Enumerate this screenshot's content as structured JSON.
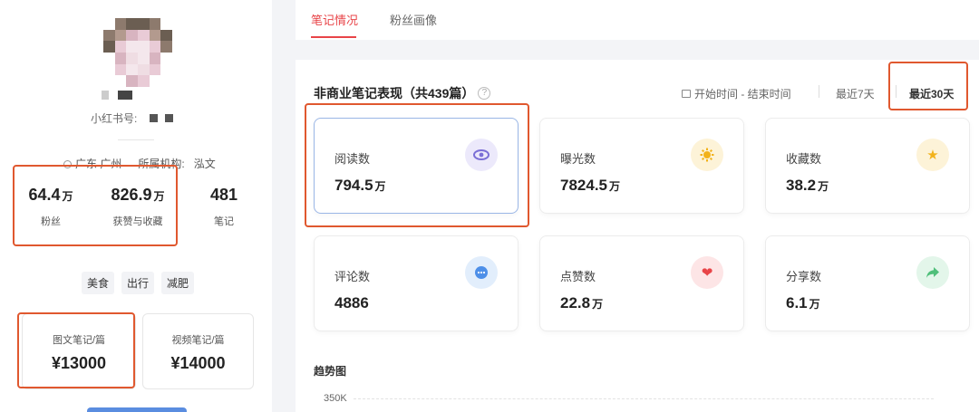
{
  "profile": {
    "uid_label": "小红书号:",
    "location": "广东 广州",
    "org_label": "所属机构:",
    "org_value": "泓文",
    "stats": [
      {
        "value": "64.4",
        "unit": "万",
        "label": "粉丝"
      },
      {
        "value": "826.9",
        "unit": "万",
        "label": "获赞与收藏"
      },
      {
        "value": "481",
        "unit": "",
        "label": "笔记"
      }
    ],
    "tags": [
      "美食",
      "出行",
      "减肥"
    ],
    "prices": [
      {
        "label": "图文笔记/篇",
        "value": "¥13000"
      },
      {
        "label": "视频笔记/篇",
        "value": "¥14000"
      }
    ]
  },
  "tabs": [
    {
      "label": "笔记情况",
      "active": true
    },
    {
      "label": "粉丝画像",
      "active": false
    }
  ],
  "section": {
    "title": "非商业笔记表现（共439篇）",
    "help": "?",
    "date_range": "开始时间 - 结束时间",
    "range_options": [
      {
        "label": "最近7天",
        "active": false
      },
      {
        "label": "最近30天",
        "active": true
      }
    ]
  },
  "metrics": [
    {
      "label": "阅读数",
      "value": "794.5",
      "unit": "万",
      "icon": "eye-icon",
      "color": "#7b6fd6",
      "bg": "#ece9fb"
    },
    {
      "label": "曝光数",
      "value": "7824.5",
      "unit": "万",
      "icon": "sun-icon",
      "color": "#f2b21b",
      "bg": "#fdf3d8"
    },
    {
      "label": "收藏数",
      "value": "38.2",
      "unit": "万",
      "icon": "star-icon",
      "color": "#f2b21b",
      "bg": "#fdf3d8"
    },
    {
      "label": "评论数",
      "value": "4886",
      "unit": "",
      "icon": "comment-icon",
      "color": "#4d8fe8",
      "bg": "#e2eefc"
    },
    {
      "label": "点赞数",
      "value": "22.8",
      "unit": "万",
      "icon": "heart-icon",
      "color": "#e84448",
      "bg": "#fde5e6"
    },
    {
      "label": "分享数",
      "value": "6.1",
      "unit": "万",
      "icon": "share-icon",
      "color": "#4fbf7a",
      "bg": "#e3f6ea"
    }
  ],
  "trend": {
    "title": "趋势图",
    "y_top": "350K"
  },
  "colors": {
    "accent": "#e84448",
    "highlight_box": "#e0582f"
  }
}
